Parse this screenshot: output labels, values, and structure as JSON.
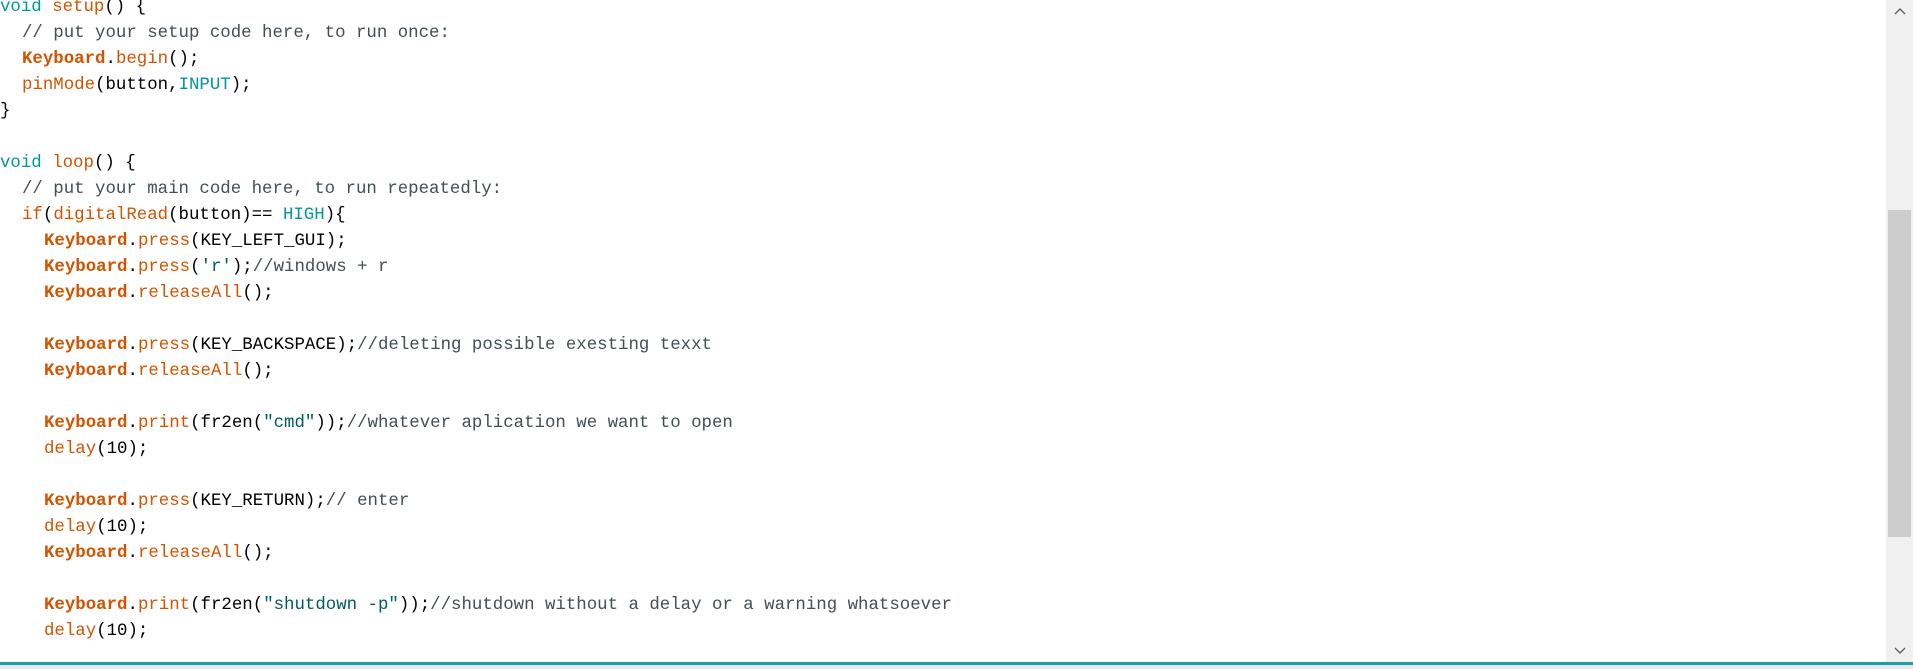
{
  "editor": {
    "lines": [
      {
        "indent": 0,
        "tokens": [
          {
            "t": "kw",
            "s": "void"
          },
          {
            "t": "txt",
            "s": " "
          },
          {
            "t": "fn",
            "s": "setup"
          },
          {
            "t": "p",
            "s": "() {"
          }
        ]
      },
      {
        "indent": 1,
        "tokens": [
          {
            "t": "cm",
            "s": "// put your setup code here, to run once:"
          }
        ]
      },
      {
        "indent": 1,
        "tokens": [
          {
            "t": "cls",
            "s": "Keyboard"
          },
          {
            "t": "p",
            "s": "."
          },
          {
            "t": "fn",
            "s": "begin"
          },
          {
            "t": "p",
            "s": "();"
          }
        ]
      },
      {
        "indent": 1,
        "tokens": [
          {
            "t": "fn",
            "s": "pinMode"
          },
          {
            "t": "p",
            "s": "(button,"
          },
          {
            "t": "kw",
            "s": "INPUT"
          },
          {
            "t": "p",
            "s": ");"
          }
        ]
      },
      {
        "indent": 0,
        "tokens": [
          {
            "t": "p",
            "s": "}"
          }
        ]
      },
      {
        "indent": 0,
        "tokens": []
      },
      {
        "indent": 0,
        "tokens": [
          {
            "t": "kw",
            "s": "void"
          },
          {
            "t": "txt",
            "s": " "
          },
          {
            "t": "fn",
            "s": "loop"
          },
          {
            "t": "p",
            "s": "() {"
          }
        ]
      },
      {
        "indent": 1,
        "tokens": [
          {
            "t": "cm",
            "s": "// put your main code here, to run repeatedly:"
          }
        ]
      },
      {
        "indent": 1,
        "tokens": [
          {
            "t": "fn",
            "s": "if"
          },
          {
            "t": "p",
            "s": "("
          },
          {
            "t": "fn",
            "s": "digitalRead"
          },
          {
            "t": "p",
            "s": "(button)== "
          },
          {
            "t": "kw",
            "s": "HIGH"
          },
          {
            "t": "p",
            "s": "){"
          }
        ]
      },
      {
        "indent": 2,
        "tokens": [
          {
            "t": "cls",
            "s": "Keyboard"
          },
          {
            "t": "p",
            "s": "."
          },
          {
            "t": "fn",
            "s": "press"
          },
          {
            "t": "p",
            "s": "(KEY_LEFT_GUI);"
          }
        ]
      },
      {
        "indent": 2,
        "tokens": [
          {
            "t": "cls",
            "s": "Keyboard"
          },
          {
            "t": "p",
            "s": "."
          },
          {
            "t": "fn",
            "s": "press"
          },
          {
            "t": "p",
            "s": "("
          },
          {
            "t": "str",
            "s": "'r'"
          },
          {
            "t": "p",
            "s": ");"
          },
          {
            "t": "cm",
            "s": "//windows + r"
          }
        ]
      },
      {
        "indent": 2,
        "tokens": [
          {
            "t": "cls",
            "s": "Keyboard"
          },
          {
            "t": "p",
            "s": "."
          },
          {
            "t": "fn",
            "s": "releaseAll"
          },
          {
            "t": "p",
            "s": "();"
          }
        ]
      },
      {
        "indent": 0,
        "tokens": []
      },
      {
        "indent": 2,
        "tokens": [
          {
            "t": "cls",
            "s": "Keyboard"
          },
          {
            "t": "p",
            "s": "."
          },
          {
            "t": "fn",
            "s": "press"
          },
          {
            "t": "p",
            "s": "(KEY_BACKSPACE);"
          },
          {
            "t": "cm",
            "s": "//deleting possible exesting texxt"
          }
        ]
      },
      {
        "indent": 2,
        "tokens": [
          {
            "t": "cls",
            "s": "Keyboard"
          },
          {
            "t": "p",
            "s": "."
          },
          {
            "t": "fn",
            "s": "releaseAll"
          },
          {
            "t": "p",
            "s": "();"
          }
        ]
      },
      {
        "indent": 0,
        "tokens": []
      },
      {
        "indent": 2,
        "tokens": [
          {
            "t": "cls",
            "s": "Keyboard"
          },
          {
            "t": "p",
            "s": "."
          },
          {
            "t": "fn",
            "s": "print"
          },
          {
            "t": "p",
            "s": "(fr2en("
          },
          {
            "t": "str",
            "s": "\"cmd\""
          },
          {
            "t": "p",
            "s": "));"
          },
          {
            "t": "cm",
            "s": "//whatever aplication we want to open"
          }
        ]
      },
      {
        "indent": 2,
        "tokens": [
          {
            "t": "fn",
            "s": "delay"
          },
          {
            "t": "p",
            "s": "(10);"
          }
        ]
      },
      {
        "indent": 0,
        "tokens": []
      },
      {
        "indent": 2,
        "tokens": [
          {
            "t": "cls",
            "s": "Keyboard"
          },
          {
            "t": "p",
            "s": "."
          },
          {
            "t": "fn",
            "s": "press"
          },
          {
            "t": "p",
            "s": "(KEY_RETURN);"
          },
          {
            "t": "cm",
            "s": "// enter"
          }
        ]
      },
      {
        "indent": 2,
        "tokens": [
          {
            "t": "fn",
            "s": "delay"
          },
          {
            "t": "p",
            "s": "(10);"
          }
        ]
      },
      {
        "indent": 2,
        "tokens": [
          {
            "t": "cls",
            "s": "Keyboard"
          },
          {
            "t": "p",
            "s": "."
          },
          {
            "t": "fn",
            "s": "releaseAll"
          },
          {
            "t": "p",
            "s": "();"
          }
        ]
      },
      {
        "indent": 0,
        "tokens": []
      },
      {
        "indent": 2,
        "tokens": [
          {
            "t": "cls",
            "s": "Keyboard"
          },
          {
            "t": "p",
            "s": "."
          },
          {
            "t": "fn",
            "s": "print"
          },
          {
            "t": "p",
            "s": "(fr2en("
          },
          {
            "t": "str",
            "s": "\"shutdown -p\""
          },
          {
            "t": "p",
            "s": "));"
          },
          {
            "t": "cm",
            "s": "//shutdown without a delay or a warning whatsoever"
          }
        ]
      },
      {
        "indent": 2,
        "tokens": [
          {
            "t": "fn",
            "s": "delay"
          },
          {
            "t": "p",
            "s": "(10);"
          }
        ]
      }
    ]
  },
  "scrollbar": {
    "up_icon": "chevron-up-icon",
    "down_icon": "chevron-down-icon",
    "scroll_position": 0.31,
    "visible_fraction": 0.53
  },
  "colors": {
    "keyword": "#00979c",
    "function": "#d35400",
    "string": "#005c5f",
    "comment": "#434f54",
    "accent": "#17a1a5"
  }
}
